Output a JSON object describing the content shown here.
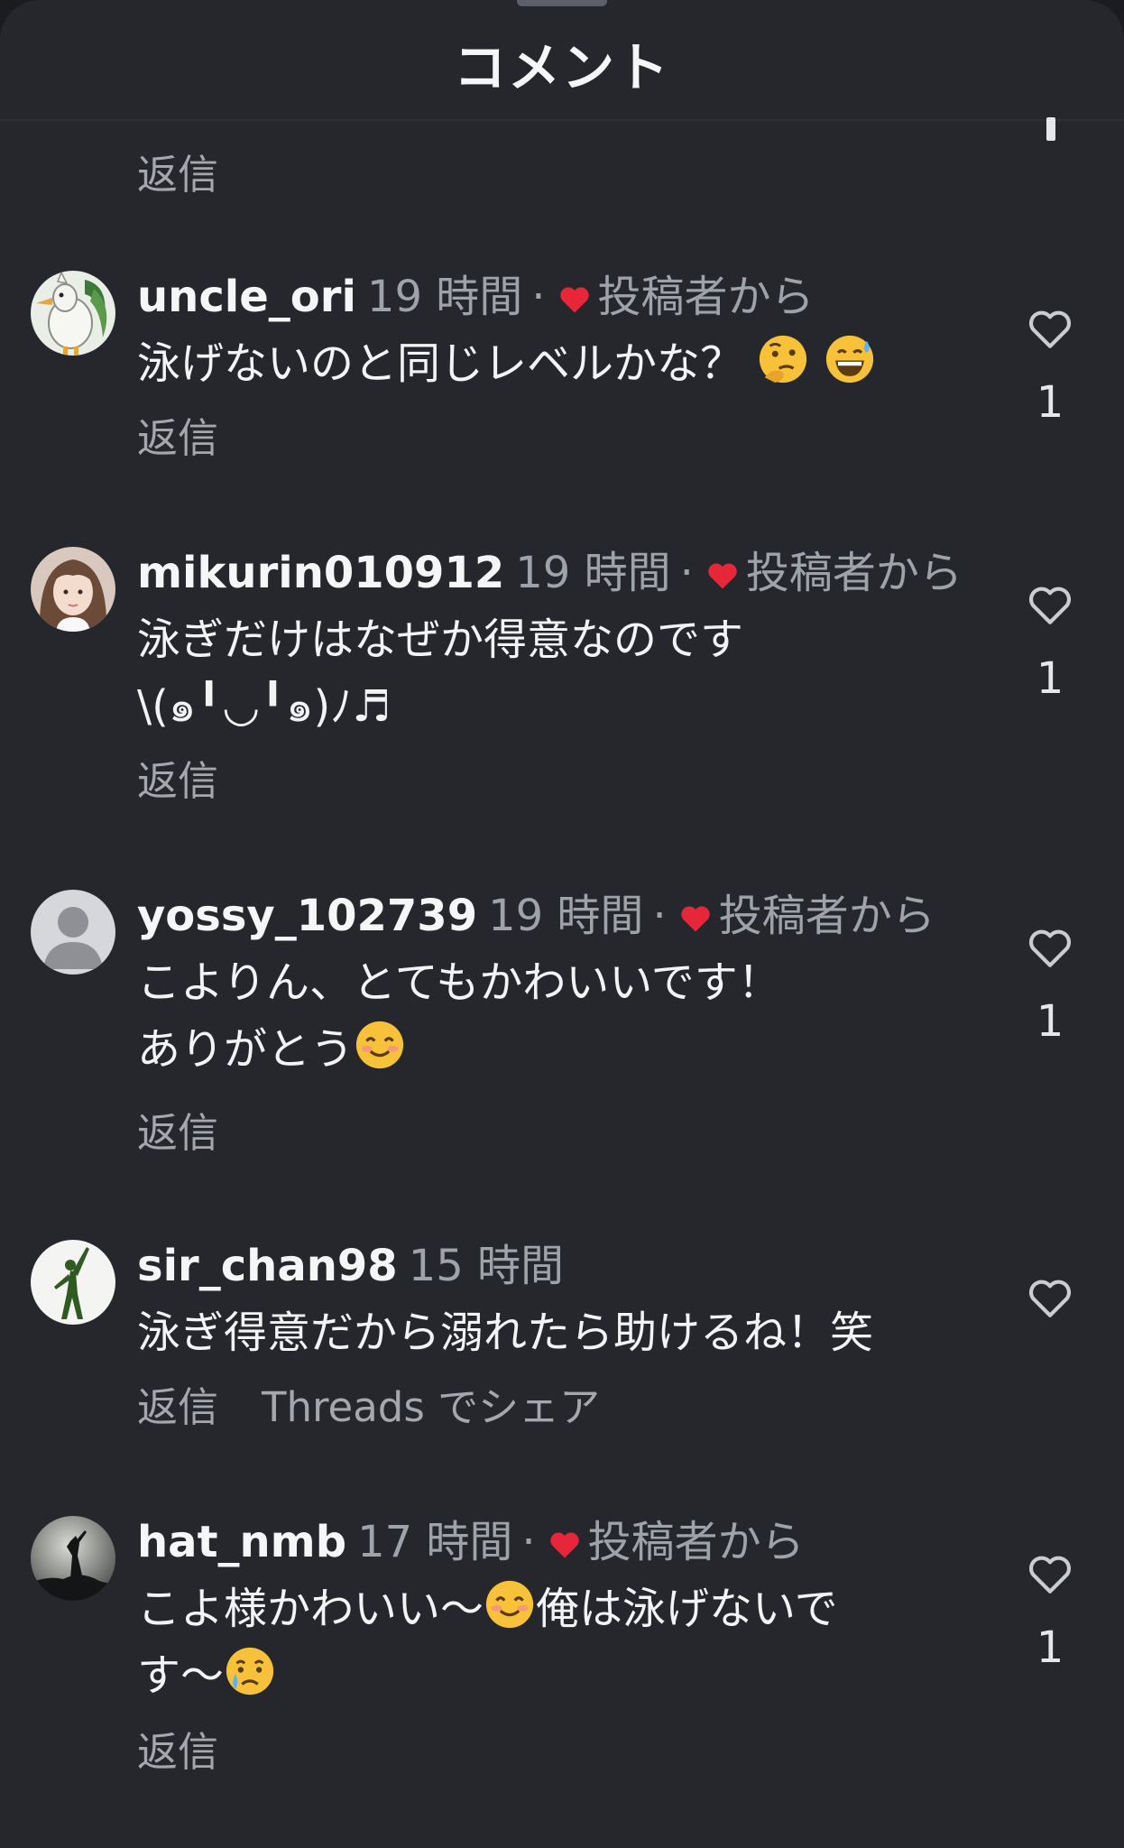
{
  "header": {
    "title": "コメント"
  },
  "top_partial": {
    "reply_label": "返信"
  },
  "comments": [
    {
      "username": "uncle_ori",
      "time": "19 時間",
      "author_liked_label": "投稿者から",
      "text": "泳げないのと同じレベルかな？",
      "emojis": [
        "thinking-face",
        "grinning-sweat-face"
      ],
      "reply_label": "返信",
      "like_count": "1"
    },
    {
      "username": "mikurin010912",
      "time": "19 時間",
      "author_liked_label": "投稿者から",
      "text_line1": "泳ぎだけはなぜか得意なのです",
      "text_line2": "\\(๑╹◡╹๑)ﾉ♬",
      "reply_label": "返信",
      "like_count": "1"
    },
    {
      "username": "yossy_102739",
      "time": "19 時間",
      "author_liked_label": "投稿者から",
      "text_line1": "こよりん、とてもかわいいです！",
      "text_line2": "ありがとう",
      "emojis": [
        "smiling-face"
      ],
      "reply_label": "返信",
      "like_count": "1"
    },
    {
      "username": "sir_chan98",
      "time": "15 時間",
      "text": "泳ぎ得意だから溺れたら助けるね！笑",
      "reply_label": "返信",
      "share_label": "Threads でシェア"
    },
    {
      "username": "hat_nmb",
      "time": "17 時間",
      "author_liked_label": "投稿者から",
      "text_part1": "こよ様かわいい〜",
      "text_part2": "俺は泳げないで",
      "text_part3": "す〜",
      "emojis": [
        "smiling-face",
        "crying-face"
      ],
      "reply_label": "返信",
      "like_count": "1"
    }
  ],
  "colors": {
    "background": "#25272c",
    "heart": "#e8263a",
    "muted_text": "#9ea2a9"
  }
}
